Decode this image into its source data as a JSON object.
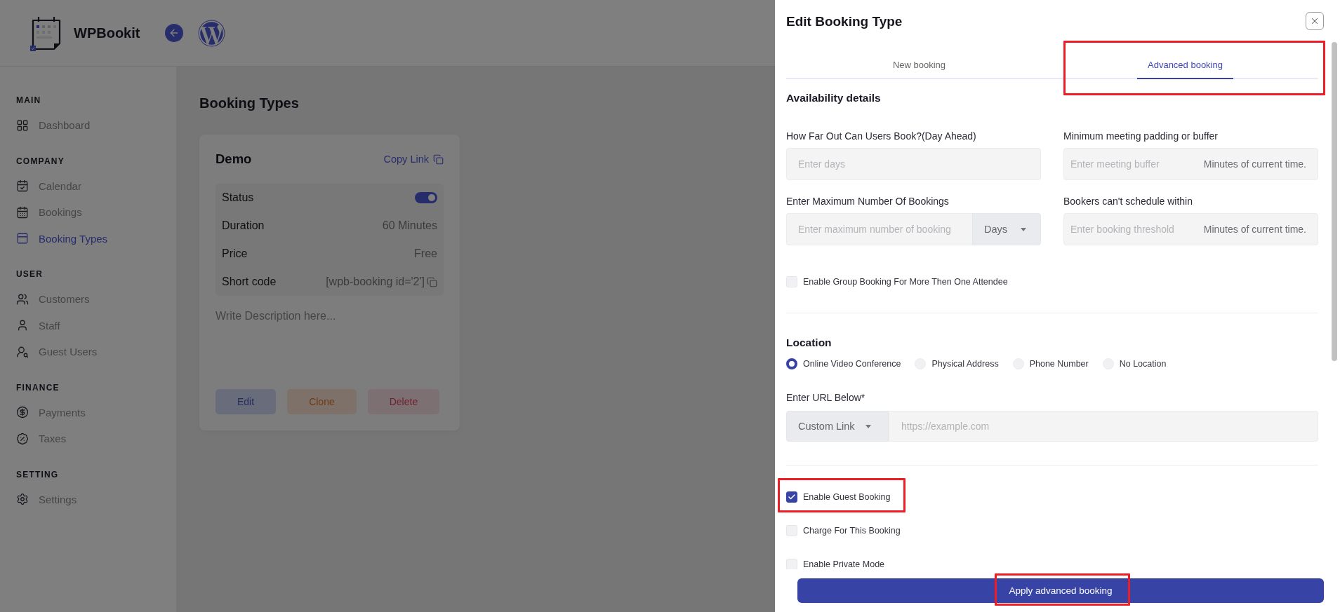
{
  "header": {
    "app_name": "WPBookit"
  },
  "sidebar": {
    "sections": [
      {
        "title": "MAIN",
        "items": [
          {
            "label": "Dashboard",
            "selected": false
          }
        ]
      },
      {
        "title": "COMPANY",
        "items": [
          {
            "label": "Calendar",
            "selected": false
          },
          {
            "label": "Bookings",
            "selected": false
          },
          {
            "label": "Booking Types",
            "selected": true
          }
        ]
      },
      {
        "title": "USER",
        "items": [
          {
            "label": "Customers",
            "selected": false
          },
          {
            "label": "Staff",
            "selected": false
          },
          {
            "label": "Guest Users",
            "selected": false
          }
        ]
      },
      {
        "title": "FINANCE",
        "items": [
          {
            "label": "Payments",
            "selected": false
          },
          {
            "label": "Taxes",
            "selected": false
          }
        ]
      },
      {
        "title": "SETTING",
        "items": [
          {
            "label": "Settings",
            "selected": false
          }
        ]
      }
    ]
  },
  "page": {
    "title": "Booking Types",
    "card": {
      "title": "Demo",
      "copy_link": "Copy Link",
      "details": [
        {
          "kind": "toggle",
          "label": "Status",
          "on": true
        },
        {
          "kind": "text",
          "label": "Duration",
          "value": "60 Minutes"
        },
        {
          "kind": "text",
          "label": "Price",
          "value": "Free"
        },
        {
          "kind": "copy",
          "label": "Short code",
          "value": "[wpb-booking id='2']"
        }
      ],
      "description": {
        "placeholder": "Write Description here..."
      },
      "buttons": [
        {
          "kind": "edit",
          "label": "Edit"
        },
        {
          "kind": "clone",
          "label": "Clone"
        },
        {
          "kind": "delete",
          "label": "Delete"
        }
      ]
    }
  },
  "drawer": {
    "title": "Edit Booking Type",
    "tabs": [
      {
        "label": "New booking",
        "selected": false,
        "highlighted": false
      },
      {
        "label": "Advanced booking",
        "selected": true,
        "highlighted": true
      }
    ],
    "availability": {
      "title": "Availability details",
      "fields": [
        {
          "kind": "text",
          "label": "How Far Out Can Users Book?(Day Ahead)",
          "placeholder": "Enter days"
        },
        {
          "kind": "unit",
          "label": "Minimum meeting padding or buffer",
          "placeholder": "Enter meeting buffer",
          "unit": "Minutes of current time."
        },
        {
          "kind": "select",
          "label": "Enter Maximum Number Of Bookings",
          "placeholder": "Enter maximum number of booking",
          "select": "Days"
        },
        {
          "kind": "unit",
          "label": "Bookers can't schedule within",
          "placeholder": "Enter booking threshold",
          "unit": "Minutes of current time."
        }
      ],
      "group_booking": {
        "label": "Enable Group Booking For More Then One Attendee",
        "checked": false
      }
    },
    "location": {
      "title": "Location",
      "options": [
        {
          "label": "Online Video Conference",
          "selected": true
        },
        {
          "label": "Physical Address",
          "selected": false
        },
        {
          "label": "Phone Number",
          "selected": false
        },
        {
          "label": "No Location",
          "selected": false
        }
      ],
      "url": {
        "label": "Enter URL Below*",
        "select": "Custom Link",
        "placeholder": "https://example.com"
      }
    },
    "settings": [
      {
        "label": "Enable Guest Booking",
        "checked": true,
        "highlighted": true
      },
      {
        "label": "Charge For This Booking",
        "checked": false,
        "highlighted": false
      },
      {
        "label": "Enable Private Mode",
        "checked": false,
        "highlighted": false
      }
    ],
    "apply_button": {
      "label": "Apply advanced booking",
      "highlighted": true
    }
  }
}
